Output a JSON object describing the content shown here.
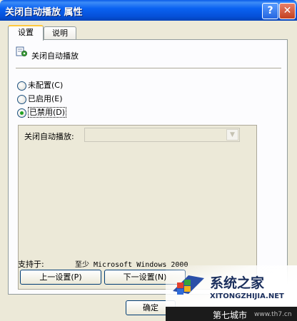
{
  "window": {
    "title": "关闭自动播放 属性",
    "help_glyph": "?",
    "close_glyph": "✕"
  },
  "tabs": [
    {
      "label": "设置"
    },
    {
      "label": "说明"
    }
  ],
  "policy": {
    "title": "关闭自动播放",
    "icon": "policy-settings-icon"
  },
  "radios": [
    {
      "label": "未配置",
      "accel": "(C)",
      "checked": false
    },
    {
      "label": "已启用",
      "accel": "(E)",
      "checked": false
    },
    {
      "label": "已禁用",
      "accel": "(D)",
      "checked": true
    }
  ],
  "options": {
    "label": "关闭自动播放:",
    "select_value": ""
  },
  "support": {
    "label": "支持于:",
    "value": "至少 Microsoft Windows 2000"
  },
  "buttons": {
    "prev": "上一设置(P)",
    "next": "下一设置(N)",
    "ok": "确定"
  },
  "watermark": {
    "name": "系统之家",
    "url": "XITONGZHIJIA.NET",
    "band": "第七城市",
    "band_url": "www.th7.cn"
  },
  "colors": {
    "titlebar": "#0a5ce8",
    "dialog_bg": "#ece9d8",
    "radio_dot": "#21a121",
    "tab_highlight": "#ffc83c"
  }
}
